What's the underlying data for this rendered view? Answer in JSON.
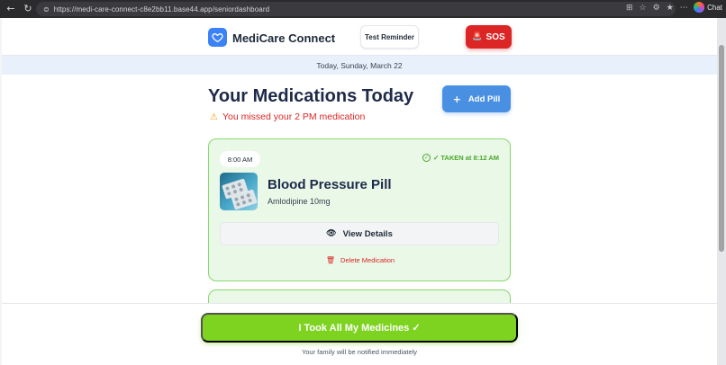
{
  "browser": {
    "url": "https://medi-care-connect-c8e2bb11.base44.app/seniordashboard",
    "chat_label": "Chat"
  },
  "header": {
    "app_title": "MediCare Connect",
    "test_reminder_label": "Test Reminder",
    "sos_label": "SOS"
  },
  "date_strip": {
    "text": "Today, Sunday, March 22"
  },
  "main": {
    "title": "Your Medications Today",
    "add_pill_label": "Add Pill",
    "missed_warning": "You missed your 2 PM medication"
  },
  "medications": [
    {
      "time": "8:00 AM",
      "status": "✓ TAKEN at 8:12 AM",
      "name": "Blood Pressure Pill",
      "dose": "Amlodipine 10mg",
      "view_label": "View Details",
      "delete_label": "Delete Medication"
    }
  ],
  "bottom": {
    "took_all_label": "I Took All My Medicines ✓",
    "family_note": "Your family will be notified immediately"
  },
  "colors": {
    "accent_blue": "#4a90e2",
    "sos_red": "#dc2626",
    "taken_green": "#4ca72d",
    "card_border": "#86d86a",
    "took_all_green": "#7ed321"
  }
}
